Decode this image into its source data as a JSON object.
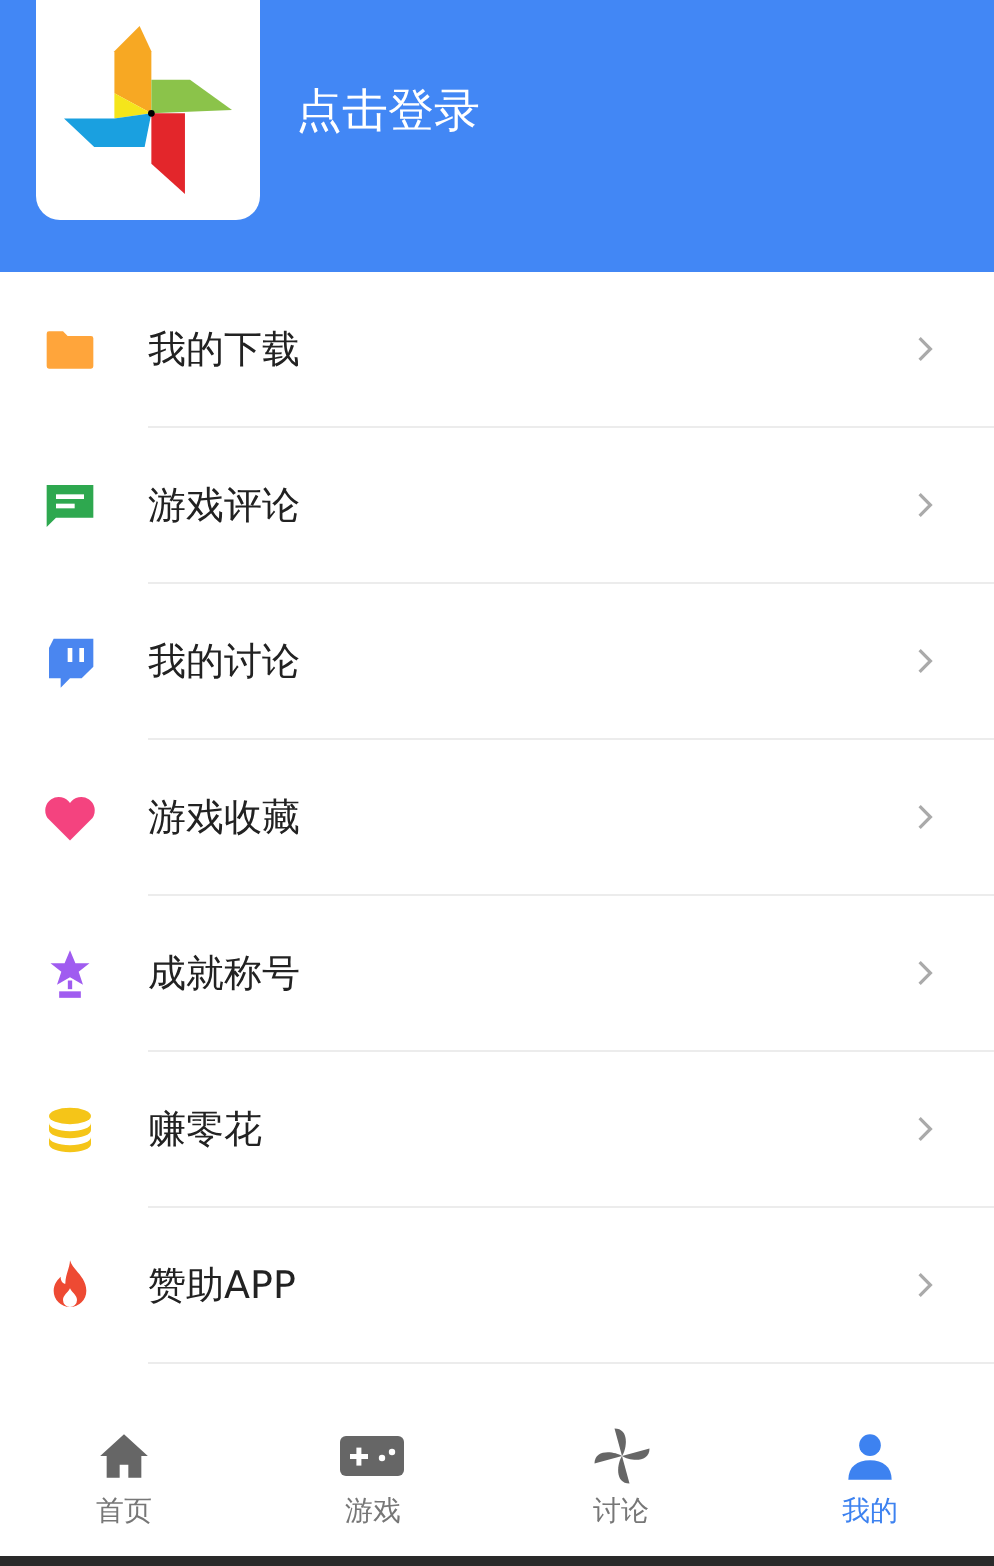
{
  "header": {
    "login_label": "点击登录"
  },
  "menu": [
    {
      "label": "我的下载",
      "kind": "folder"
    },
    {
      "label": "游戏评论",
      "kind": "comment"
    },
    {
      "label": "我的讨论",
      "kind": "discussion"
    },
    {
      "label": "游戏收藏",
      "kind": "heart"
    },
    {
      "label": "成就称号",
      "kind": "trophy"
    },
    {
      "label": "赚零花",
      "kind": "coins"
    },
    {
      "label": "赞助APP",
      "kind": "flame"
    }
  ],
  "bottom_nav": [
    {
      "label": "首页",
      "kind": "home",
      "selected": false
    },
    {
      "label": "游戏",
      "kind": "gamepad",
      "selected": false
    },
    {
      "label": "讨论",
      "kind": "pinwheel",
      "selected": false
    },
    {
      "label": "我的",
      "kind": "person",
      "selected": true
    }
  ]
}
